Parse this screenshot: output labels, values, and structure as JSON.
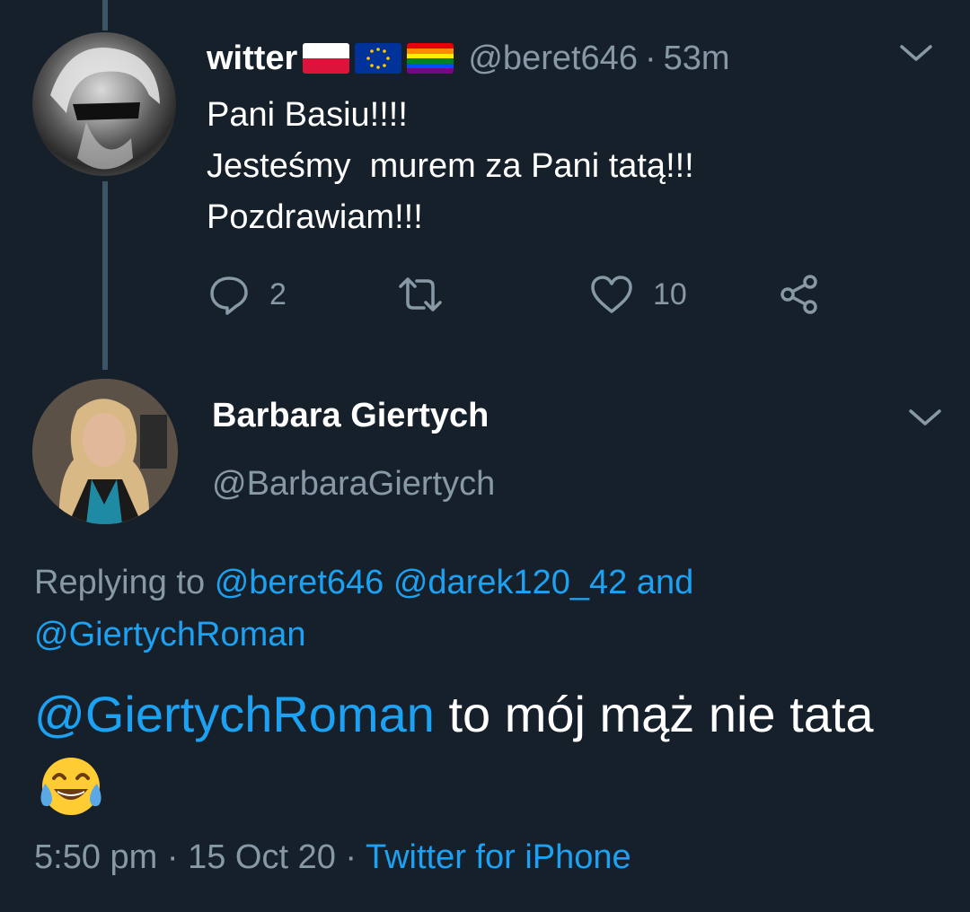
{
  "tweet1": {
    "display_name": "witter",
    "handle": "@beret646",
    "separator": "·",
    "time": "53m",
    "lines": [
      "Pani Basiu!!!!",
      "Jesteśmy  murem za Pani tatą!!!",
      "Pozdrawiam!!!"
    ],
    "flags": [
      "poland-flag",
      "eu-flag",
      "rainbow-flag"
    ],
    "replies": "2",
    "likes": "10"
  },
  "tweet2": {
    "display_name": "Barbara Giertych",
    "handle": "@BarbaraGiertych",
    "replying_prefix": "Replying to",
    "replying_to": [
      "@beret646",
      "@darek120_42"
    ],
    "replying_and": "and",
    "replying_last": "@GiertychRoman",
    "body_mention": "@GiertychRoman",
    "body_text": "to mój mąż nie tata",
    "emoji": "face-with-tears-of-joy",
    "time": "5:50 pm",
    "date": "15 Oct 20",
    "separator": "·",
    "source": "Twitter for iPhone"
  },
  "colors": {
    "background": "#15202b",
    "muted": "#8899a6",
    "link": "#1da1f2",
    "thread_line": "#3d5466"
  }
}
